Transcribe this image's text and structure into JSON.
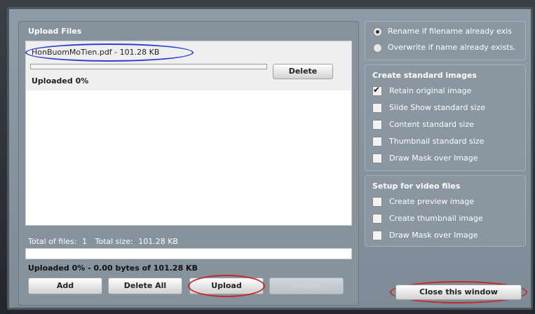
{
  "upload_panel": {
    "title": "Upload Files",
    "file": {
      "name_size": "HonBuomMoTien.pdf - 101.28 KB",
      "progress_percent": 0,
      "status": "Uploaded 0%",
      "delete_label": "Delete"
    },
    "totals": {
      "files_label": "Total of files:",
      "files_value": "1",
      "size_label": "Total size:",
      "size_value": "101.28 KB"
    },
    "status_line": "Uploaded 0% - 0.00 bytes of 101.28 KB",
    "buttons": {
      "add": "Add",
      "delete_all": "Delete All",
      "upload": "Upload",
      "cancel": "Cancel"
    }
  },
  "options": {
    "radio_rename": "Rename if filename already exis",
    "radio_overwrite": "Overwrite if name already exists.",
    "standard_images": {
      "title": "Create standard images",
      "items": [
        {
          "label": "Retain original image",
          "checked": true
        },
        {
          "label": "Slide Show standard size",
          "checked": false
        },
        {
          "label": "Content standard size",
          "checked": false
        },
        {
          "label": "Thumbnail standard size",
          "checked": false
        },
        {
          "label": "Draw Mask over Image",
          "checked": false
        }
      ]
    },
    "video_files": {
      "title": "Setup for video files",
      "items": [
        {
          "label": "Create preview image",
          "checked": false
        },
        {
          "label": "Create thumbnail image",
          "checked": false
        },
        {
          "label": "Draw Mask over Image",
          "checked": false
        }
      ]
    },
    "close_label": "Close this window"
  },
  "colors": {
    "annotation_red": "#c42b2b",
    "annotation_blue": "#2a3ed0"
  }
}
